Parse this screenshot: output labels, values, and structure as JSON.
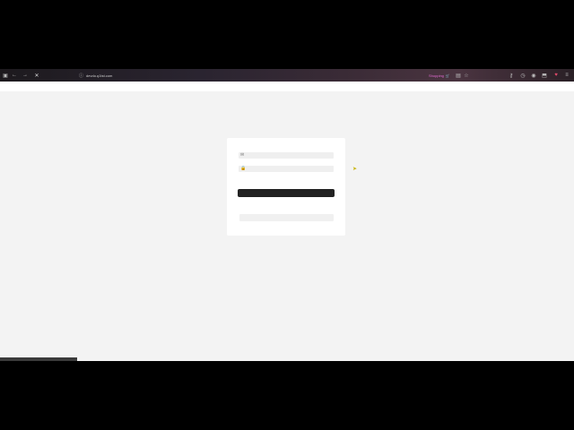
{
  "browser": {
    "url": "devdo.q1tst.com",
    "page_loading": true,
    "tag_label": "Shopping",
    "icons": [
      "sidebar-icon",
      "back-icon",
      "forward-icon",
      "stop-icon",
      "site-info-icon",
      "shopping-icon",
      "reader-icon",
      "bookmark-star-icon",
      "extension-icon",
      "history-icon",
      "account-icon",
      "extensions-puzzle-icon",
      "pocket-icon",
      "menu-icon"
    ]
  },
  "login_form": {
    "username": {
      "value": "",
      "placeholder": "",
      "icon": "mail-icon"
    },
    "password": {
      "value": "",
      "placeholder": "",
      "icon": "lock-icon"
    },
    "submit_label": "",
    "secondary_label": ""
  },
  "status_bar": {
    "text": ""
  },
  "colors": {
    "page_bg": "#f3f3f3",
    "card_bg": "#ffffff",
    "button_bg": "#222222",
    "field_bg": "#efefef",
    "tag": "#e06bd0"
  }
}
